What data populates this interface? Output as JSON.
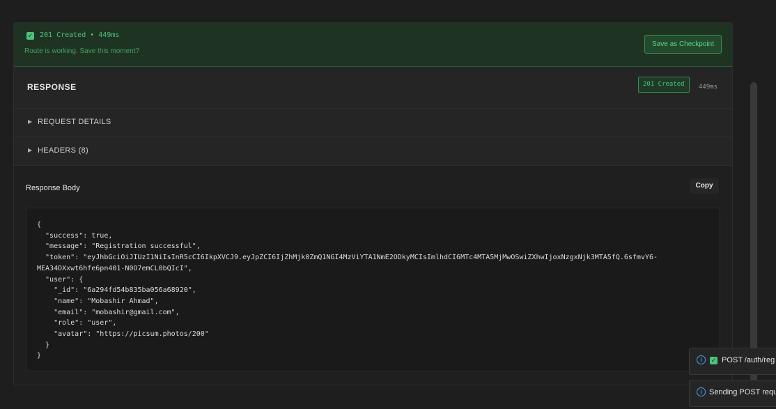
{
  "banner": {
    "status": "201 Created • 449ms",
    "subtext": "Route is working. Save this moment?",
    "checkpoint_label": "Save as Checkpoint"
  },
  "response": {
    "title": "RESPONSE",
    "badge": "201 Created",
    "time": "449ms"
  },
  "sections": {
    "request_details": "REQUEST DETAILS",
    "headers": "HEADERS (8)"
  },
  "body": {
    "label": "Response Body",
    "copy_label": "Copy",
    "json_text": "{\n  \"success\": true,\n  \"message\": \"Registration successful\",\n  \"token\": \"eyJhbGciOiJIUzI1NiIsInR5cCI6IkpXVCJ9.eyJpZCI6IjZhMjk0ZmQ1NGI4MzViYTA1NmE2ODkyMCIsImlhdCI6MTc4MTA5MjMwOSwiZXhwIjoxNzgxNjk3MTA5fQ.6sfmvY6-\nMEA34DXxwt6hfe6pn401-N0O7emCL0bQIcI\",\n  \"user\": {\n    \"_id\": \"6a294fd54b835ba056a68920\",\n    \"name\": \"Mobashir Ahmad\",\n    \"email\": \"mobashir@gmail.com\",\n    \"role\": \"user\",\n    \"avatar\": \"https://picsum.photos/200\"\n  }\n}"
  },
  "toasts": [
    {
      "text": "POST /auth/reg"
    },
    {
      "text": "Sending POST requ"
    }
  ],
  "colors": {
    "success": "#4ec27a",
    "info": "#4aa3e8",
    "background": "#1e1e1e"
  }
}
